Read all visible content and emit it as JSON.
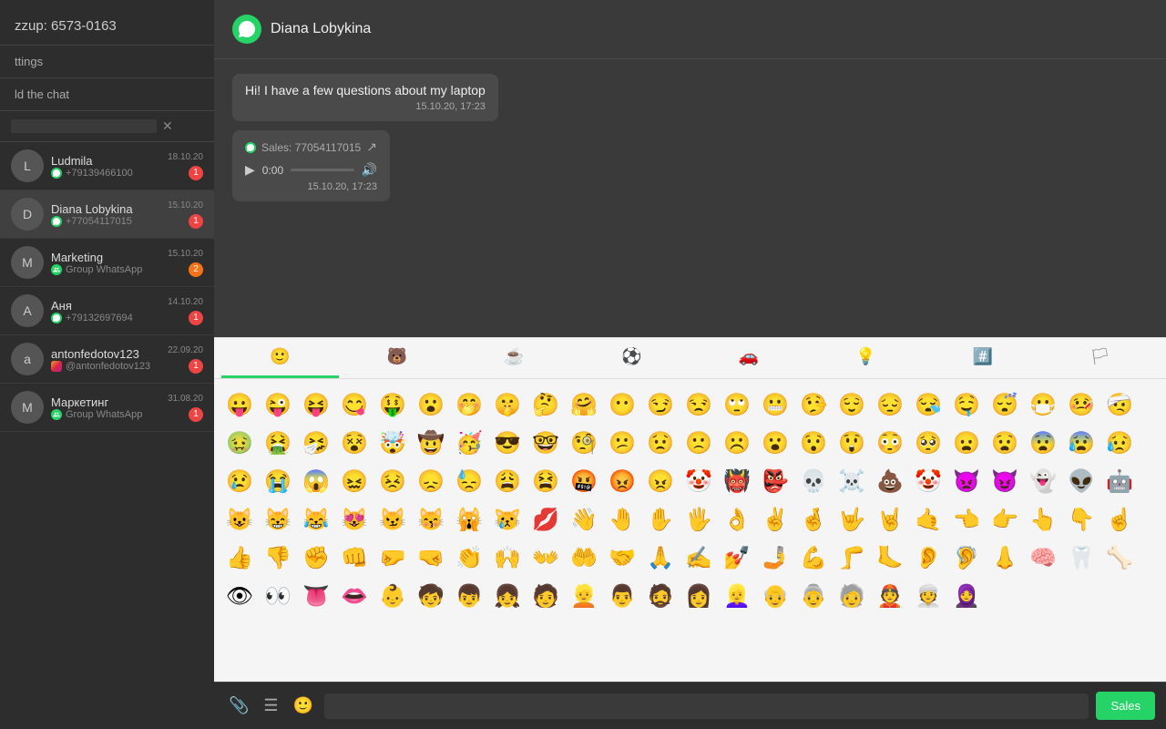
{
  "app": {
    "title": "zzup: 6573-0163"
  },
  "sidebar": {
    "title": "zzup: 6573-0163",
    "settings_label": "ttings",
    "add_chat_label": "ld the chat",
    "search_placeholder": "",
    "chats": [
      {
        "name": "Ludmila",
        "sub": "+79139466100",
        "time": "18.10.20",
        "badge": "1",
        "type": "whatsapp"
      },
      {
        "name": "Diana Lobykina",
        "sub": "+77054117015",
        "time": "15.10.20",
        "badge": "1",
        "type": "whatsapp"
      },
      {
        "name": "Marketing",
        "sub": "Group WhatsApp",
        "time": "15.10.20",
        "badge": "2",
        "type": "group"
      },
      {
        "name": "Аня",
        "sub": "+79132697694",
        "time": "14.10.20",
        "badge": "1",
        "type": "whatsapp"
      },
      {
        "name": "antonfedotov123",
        "sub": "@antonfedotov123",
        "time": "22.09.20",
        "badge": "1",
        "type": "instagram"
      },
      {
        "name": "Маркетинг",
        "sub": "Group WhatsApp",
        "time": "31.08.20",
        "badge": "1",
        "type": "group"
      }
    ]
  },
  "chat_header": {
    "name": "Diana Lobykina"
  },
  "messages": [
    {
      "text": "Hi! I have a few questions about my laptop",
      "time": "15.10.20, 17:23",
      "type": "text"
    },
    {
      "source": "Sales: 77054117015",
      "audio_time": "0:00",
      "time": "15.10.20, 17:23",
      "type": "audio"
    }
  ],
  "emoji_tabs": [
    {
      "icon": "🙂",
      "label": "smileys",
      "active": true
    },
    {
      "icon": "🐻",
      "label": "animals",
      "active": false
    },
    {
      "icon": "☕",
      "label": "food",
      "active": false
    },
    {
      "icon": "⚽",
      "label": "activities",
      "active": false
    },
    {
      "icon": "🚗",
      "label": "travel",
      "active": false
    },
    {
      "icon": "💡",
      "label": "objects",
      "active": false
    },
    {
      "icon": "#️⃣",
      "label": "symbols",
      "active": false
    },
    {
      "icon": "🏳",
      "label": "flags",
      "active": false
    }
  ],
  "emojis": [
    "😛",
    "😜",
    "😝",
    "😋",
    "🤑",
    "😮",
    "🤭",
    "🤫",
    "🤔",
    "🤗",
    "😶",
    "😏",
    "😒",
    "🙄",
    "😬",
    "🤥",
    "😌",
    "😔",
    "😪",
    "🤤",
    "😴",
    "😷",
    "🤒",
    "🤕",
    "🤢",
    "🤮",
    "🤧",
    "😵",
    "🤯",
    "🤠",
    "🥳",
    "😎",
    "🤓",
    "🧐",
    "😕",
    "😟",
    "🙁",
    "☹️",
    "😮",
    "😯",
    "😲",
    "😳",
    "🥺",
    "😦",
    "😧",
    "😨",
    "😰",
    "😥",
    "😢",
    "😭",
    "😱",
    "😖",
    "😣",
    "😞",
    "😓",
    "😩",
    "😫",
    "🤬",
    "😡",
    "😠",
    "🤡",
    "👹",
    "👺",
    "💀",
    "☠️",
    "💩",
    "🤡",
    "👿",
    "😈",
    "👻",
    "👽",
    "🤖",
    "😺",
    "😸",
    "😹",
    "😻",
    "😼",
    "😽",
    "🙀",
    "😿",
    "💋",
    "👋",
    "🤚",
    "✋",
    "🖐",
    "👌",
    "✌️",
    "🤞",
    "🤟",
    "🤘",
    "🤙",
    "👈",
    "👉",
    "👆",
    "👇",
    "☝️",
    "👍",
    "👎",
    "✊",
    "👊",
    "🤛",
    "🤜",
    "👏",
    "🙌",
    "👐",
    "🤲",
    "🤝",
    "🙏",
    "✍️",
    "💅",
    "🤳",
    "💪",
    "🦵",
    "🦶",
    "👂",
    "🦻",
    "👃",
    "🧠",
    "🦷",
    "🦴",
    "👁",
    "👀",
    "👅",
    "👄",
    "👶",
    "🧒",
    "👦",
    "👧",
    "🧑",
    "👱",
    "👨",
    "🧔",
    "👩",
    "👱‍♀️",
    "👴",
    "👵",
    "🧓",
    "👲",
    "👳",
    "🧕"
  ],
  "bottom_bar": {
    "attach_label": "attach",
    "list_label": "list",
    "emoji_label": "emoji",
    "send_label": "Sales"
  }
}
